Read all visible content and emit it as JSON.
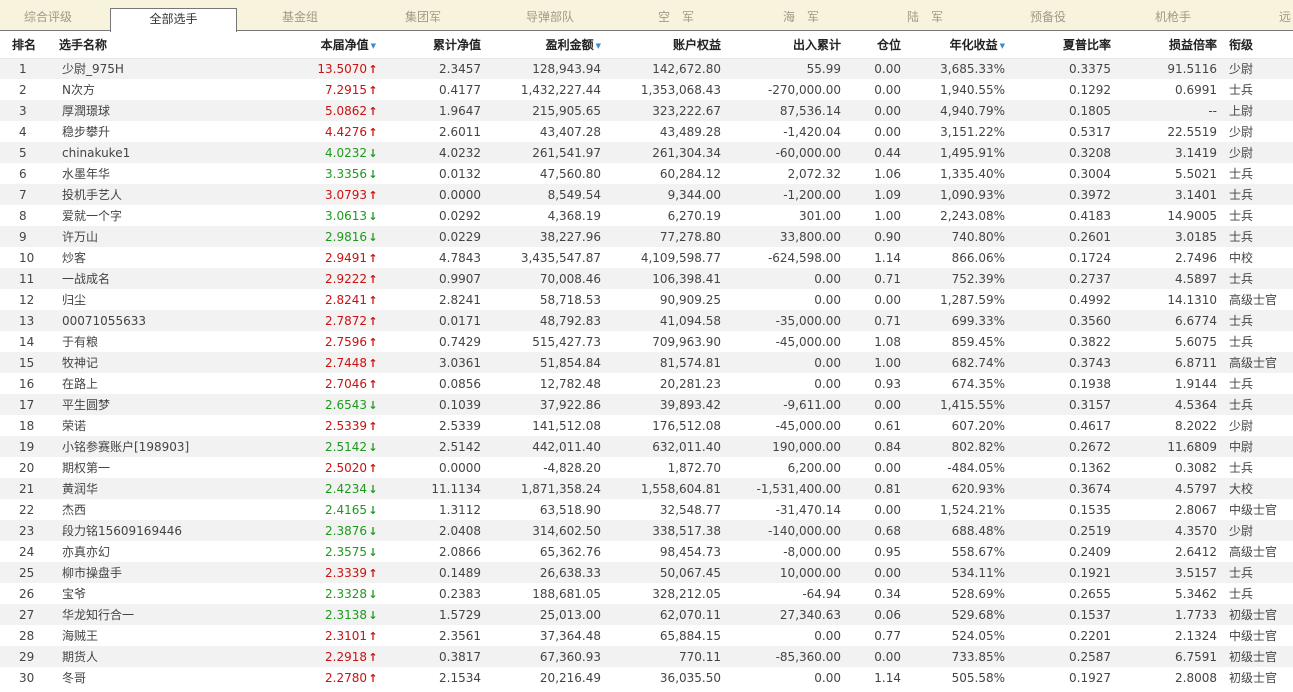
{
  "tabs": [
    {
      "label": "综合评级",
      "active": false
    },
    {
      "label": "全部选手",
      "active": true
    },
    {
      "label": "基金组",
      "active": false
    },
    {
      "label": "集团军",
      "active": false
    },
    {
      "label": "导弹部队",
      "active": false
    },
    {
      "label": "空　军",
      "active": false
    },
    {
      "label": "海　军",
      "active": false
    },
    {
      "label": "陆　军",
      "active": false
    },
    {
      "label": "预备役",
      "active": false
    },
    {
      "label": "机枪手",
      "active": false
    },
    {
      "label": "远",
      "active": false
    }
  ],
  "colors": {
    "up": "#cc1111",
    "down": "#1d9a1d",
    "sort_indicator": "#3a8ad8"
  },
  "table": {
    "headers": {
      "rank": "排名",
      "name": "选手名称",
      "nav": "本届净值",
      "cum_nav": "累计净值",
      "pnl": "盈利金额",
      "equity": "账户权益",
      "inout": "出入累计",
      "position": "仓位",
      "annual": "年化收益",
      "sharpe": "夏普比率",
      "lossratio": "损益倍率",
      "level": "衔级"
    },
    "sorted_columns": [
      "nav",
      "pnl",
      "annual"
    ],
    "rows": [
      {
        "rank": "1",
        "name": "少尉_975H",
        "nav": "13.5070",
        "dir": "up",
        "cum_nav": "2.3457",
        "pnl": "128,943.94",
        "equity": "142,672.80",
        "inout": "55.99",
        "position": "0.00",
        "annual": "3,685.33%",
        "sharpe": "0.3375",
        "lossratio": "91.5116",
        "level": "少尉"
      },
      {
        "rank": "2",
        "name": "N次方",
        "nav": "7.2915",
        "dir": "up",
        "cum_nav": "0.4177",
        "pnl": "1,432,227.44",
        "equity": "1,353,068.43",
        "inout": "-270,000.00",
        "position": "0.00",
        "annual": "1,940.55%",
        "sharpe": "0.1292",
        "lossratio": "0.6991",
        "level": "士兵"
      },
      {
        "rank": "3",
        "name": "厚潤璟球",
        "nav": "5.0862",
        "dir": "up",
        "cum_nav": "1.9647",
        "pnl": "215,905.65",
        "equity": "323,222.67",
        "inout": "87,536.14",
        "position": "0.00",
        "annual": "4,940.79%",
        "sharpe": "0.1805",
        "lossratio": "--",
        "level": "上尉"
      },
      {
        "rank": "4",
        "name": "稳步攀升",
        "nav": "4.4276",
        "dir": "up",
        "cum_nav": "2.6011",
        "pnl": "43,407.28",
        "equity": "43,489.28",
        "inout": "-1,420.04",
        "position": "0.00",
        "annual": "3,151.22%",
        "sharpe": "0.5317",
        "lossratio": "22.5519",
        "level": "少尉"
      },
      {
        "rank": "5",
        "name": "chinakuke1",
        "nav": "4.0232",
        "dir": "down",
        "cum_nav": "4.0232",
        "pnl": "261,541.97",
        "equity": "261,304.34",
        "inout": "-60,000.00",
        "position": "0.44",
        "annual": "1,495.91%",
        "sharpe": "0.3208",
        "lossratio": "3.1419",
        "level": "少尉"
      },
      {
        "rank": "6",
        "name": "水墨年华",
        "nav": "3.3356",
        "dir": "down",
        "cum_nav": "0.0132",
        "pnl": "47,560.80",
        "equity": "60,284.12",
        "inout": "2,072.32",
        "position": "1.06",
        "annual": "1,335.40%",
        "sharpe": "0.3004",
        "lossratio": "5.5021",
        "level": "士兵"
      },
      {
        "rank": "7",
        "name": "投机手艺人",
        "nav": "3.0793",
        "dir": "up",
        "cum_nav": "0.0000",
        "pnl": "8,549.54",
        "equity": "9,344.00",
        "inout": "-1,200.00",
        "position": "1.09",
        "annual": "1,090.93%",
        "sharpe": "0.3972",
        "lossratio": "3.1401",
        "level": "士兵"
      },
      {
        "rank": "8",
        "name": "爱就一个字",
        "nav": "3.0613",
        "dir": "down",
        "cum_nav": "0.0292",
        "pnl": "4,368.19",
        "equity": "6,270.19",
        "inout": "301.00",
        "position": "1.00",
        "annual": "2,243.08%",
        "sharpe": "0.4183",
        "lossratio": "14.9005",
        "level": "士兵"
      },
      {
        "rank": "9",
        "name": "许万山",
        "nav": "2.9816",
        "dir": "down",
        "cum_nav": "0.0229",
        "pnl": "38,227.96",
        "equity": "77,278.80",
        "inout": "33,800.00",
        "position": "0.90",
        "annual": "740.80%",
        "sharpe": "0.2601",
        "lossratio": "3.0185",
        "level": "士兵"
      },
      {
        "rank": "10",
        "name": "炒客",
        "nav": "2.9491",
        "dir": "up",
        "cum_nav": "4.7843",
        "pnl": "3,435,547.87",
        "equity": "4,109,598.77",
        "inout": "-624,598.00",
        "position": "1.14",
        "annual": "866.06%",
        "sharpe": "0.1724",
        "lossratio": "2.7496",
        "level": "中校"
      },
      {
        "rank": "11",
        "name": "一战成名",
        "nav": "2.9222",
        "dir": "up",
        "cum_nav": "0.9907",
        "pnl": "70,008.46",
        "equity": "106,398.41",
        "inout": "0.00",
        "position": "0.71",
        "annual": "752.39%",
        "sharpe": "0.2737",
        "lossratio": "4.5897",
        "level": "士兵"
      },
      {
        "rank": "12",
        "name": "归尘",
        "nav": "2.8241",
        "dir": "up",
        "cum_nav": "2.8241",
        "pnl": "58,718.53",
        "equity": "90,909.25",
        "inout": "0.00",
        "position": "0.00",
        "annual": "1,287.59%",
        "sharpe": "0.4992",
        "lossratio": "14.1310",
        "level": "高级士官"
      },
      {
        "rank": "13",
        "name": "00071055633",
        "nav": "2.7872",
        "dir": "up",
        "cum_nav": "0.0171",
        "pnl": "48,792.83",
        "equity": "41,094.58",
        "inout": "-35,000.00",
        "position": "0.71",
        "annual": "699.33%",
        "sharpe": "0.3560",
        "lossratio": "6.6774",
        "level": "士兵"
      },
      {
        "rank": "14",
        "name": "于有粮",
        "nav": "2.7596",
        "dir": "up",
        "cum_nav": "0.7429",
        "pnl": "515,427.73",
        "equity": "709,963.90",
        "inout": "-45,000.00",
        "position": "1.08",
        "annual": "859.45%",
        "sharpe": "0.3822",
        "lossratio": "5.6075",
        "level": "士兵"
      },
      {
        "rank": "15",
        "name": "牧神记",
        "nav": "2.7448",
        "dir": "up",
        "cum_nav": "3.0361",
        "pnl": "51,854.84",
        "equity": "81,574.81",
        "inout": "0.00",
        "position": "1.00",
        "annual": "682.74%",
        "sharpe": "0.3743",
        "lossratio": "6.8711",
        "level": "高级士官"
      },
      {
        "rank": "16",
        "name": "在路上",
        "nav": "2.7046",
        "dir": "up",
        "cum_nav": "0.0856",
        "pnl": "12,782.48",
        "equity": "20,281.23",
        "inout": "0.00",
        "position": "0.93",
        "annual": "674.35%",
        "sharpe": "0.1938",
        "lossratio": "1.9144",
        "level": "士兵"
      },
      {
        "rank": "17",
        "name": "平生圆梦",
        "nav": "2.6543",
        "dir": "down",
        "cum_nav": "0.1039",
        "pnl": "37,922.86",
        "equity": "39,893.42",
        "inout": "-9,611.00",
        "position": "0.00",
        "annual": "1,415.55%",
        "sharpe": "0.3157",
        "lossratio": "4.5364",
        "level": "士兵"
      },
      {
        "rank": "18",
        "name": "荣诺",
        "nav": "2.5339",
        "dir": "up",
        "cum_nav": "2.5339",
        "pnl": "141,512.08",
        "equity": "176,512.08",
        "inout": "-45,000.00",
        "position": "0.61",
        "annual": "607.20%",
        "sharpe": "0.4617",
        "lossratio": "8.2022",
        "level": "少尉"
      },
      {
        "rank": "19",
        "name": "小铭参赛账户[198903]",
        "nav": "2.5142",
        "dir": "down",
        "cum_nav": "2.5142",
        "pnl": "442,011.40",
        "equity": "632,011.40",
        "inout": "190,000.00",
        "position": "0.84",
        "annual": "802.82%",
        "sharpe": "0.2672",
        "lossratio": "11.6809",
        "level": "中尉"
      },
      {
        "rank": "20",
        "name": "期权第一",
        "nav": "2.5020",
        "dir": "up",
        "cum_nav": "0.0000",
        "pnl": "-4,828.20",
        "equity": "1,872.70",
        "inout": "6,200.00",
        "position": "0.00",
        "annual": "-484.05%",
        "sharpe": "0.1362",
        "lossratio": "0.3082",
        "level": "士兵"
      },
      {
        "rank": "21",
        "name": "黄润华",
        "nav": "2.4234",
        "dir": "down",
        "cum_nav": "11.1134",
        "pnl": "1,871,358.24",
        "equity": "1,558,604.81",
        "inout": "-1,531,400.00",
        "position": "0.81",
        "annual": "620.93%",
        "sharpe": "0.3674",
        "lossratio": "4.5797",
        "level": "大校"
      },
      {
        "rank": "22",
        "name": "杰西",
        "nav": "2.4165",
        "dir": "down",
        "cum_nav": "1.3112",
        "pnl": "63,518.90",
        "equity": "32,548.77",
        "inout": "-31,470.14",
        "position": "0.00",
        "annual": "1,524.21%",
        "sharpe": "0.1535",
        "lossratio": "2.8067",
        "level": "中级士官"
      },
      {
        "rank": "23",
        "name": "段力铭15609169446",
        "nav": "2.3876",
        "dir": "down",
        "cum_nav": "2.0408",
        "pnl": "314,602.50",
        "equity": "338,517.38",
        "inout": "-140,000.00",
        "position": "0.68",
        "annual": "688.48%",
        "sharpe": "0.2519",
        "lossratio": "4.3570",
        "level": "少尉"
      },
      {
        "rank": "24",
        "name": "亦真亦幻",
        "nav": "2.3575",
        "dir": "down",
        "cum_nav": "2.0866",
        "pnl": "65,362.76",
        "equity": "98,454.73",
        "inout": "-8,000.00",
        "position": "0.95",
        "annual": "558.67%",
        "sharpe": "0.2409",
        "lossratio": "2.6412",
        "level": "高级士官"
      },
      {
        "rank": "25",
        "name": "柳市操盘手",
        "nav": "2.3339",
        "dir": "up",
        "cum_nav": "0.1489",
        "pnl": "26,638.33",
        "equity": "50,067.45",
        "inout": "10,000.00",
        "position": "0.00",
        "annual": "534.11%",
        "sharpe": "0.1921",
        "lossratio": "3.5157",
        "level": "士兵"
      },
      {
        "rank": "26",
        "name": "宝爷",
        "nav": "2.3328",
        "dir": "down",
        "cum_nav": "0.2383",
        "pnl": "188,681.05",
        "equity": "328,212.05",
        "inout": "-64.94",
        "position": "0.34",
        "annual": "528.69%",
        "sharpe": "0.2655",
        "lossratio": "5.3462",
        "level": "士兵"
      },
      {
        "rank": "27",
        "name": "华龙知行合一",
        "nav": "2.3138",
        "dir": "down",
        "cum_nav": "1.5729",
        "pnl": "25,013.00",
        "equity": "62,070.11",
        "inout": "27,340.63",
        "position": "0.06",
        "annual": "529.68%",
        "sharpe": "0.1537",
        "lossratio": "1.7733",
        "level": "初级士官"
      },
      {
        "rank": "28",
        "name": "海贼王",
        "nav": "2.3101",
        "dir": "up",
        "cum_nav": "2.3561",
        "pnl": "37,364.48",
        "equity": "65,884.15",
        "inout": "0.00",
        "position": "0.77",
        "annual": "524.05%",
        "sharpe": "0.2201",
        "lossratio": "2.1324",
        "level": "中级士官"
      },
      {
        "rank": "29",
        "name": "期货人",
        "nav": "2.2918",
        "dir": "up",
        "cum_nav": "0.3817",
        "pnl": "67,360.93",
        "equity": "770.11",
        "inout": "-85,360.00",
        "position": "0.00",
        "annual": "733.85%",
        "sharpe": "0.2587",
        "lossratio": "6.7591",
        "level": "初级士官"
      },
      {
        "rank": "30",
        "name": "冬哥",
        "nav": "2.2780",
        "dir": "up",
        "cum_nav": "2.1534",
        "pnl": "20,216.49",
        "equity": "36,035.50",
        "inout": "0.00",
        "position": "1.14",
        "annual": "505.58%",
        "sharpe": "0.1927",
        "lossratio": "2.8008",
        "level": "初级士官"
      }
    ]
  }
}
